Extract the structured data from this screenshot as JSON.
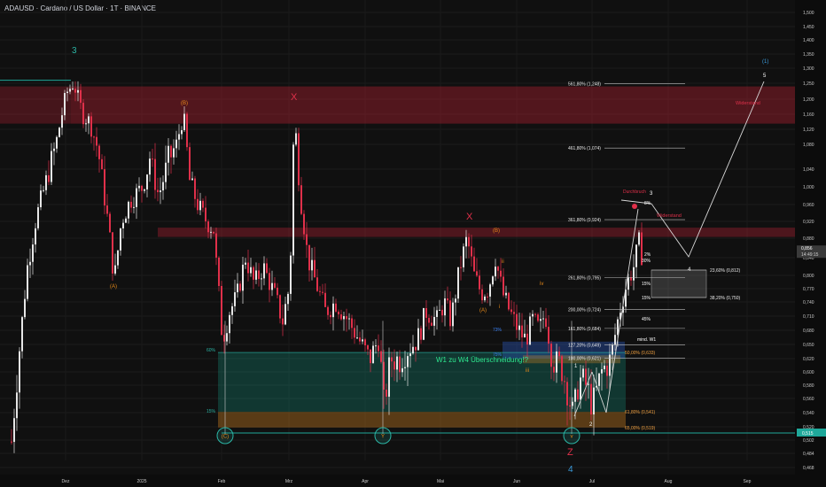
{
  "header": {
    "title": "ADAUSD · Cardano / US Dollar · 1T · BINANCE"
  },
  "chart_data": {
    "type": "candlestick",
    "price_axis": {
      "ticks": [
        "1,500",
        "1,450",
        "1,400",
        "1,350",
        "1,300",
        "1,250",
        "1,200",
        "1,160",
        "1,120",
        "1,080",
        "1,040",
        "1,000",
        "0,960",
        "0,920",
        "0,880",
        "0,840",
        "0,800",
        "0,770",
        "0,740",
        "0,710",
        "0,680",
        "0,650",
        "0,620",
        "0,600",
        "0,580",
        "0,560",
        "0,540",
        "0,520",
        "0,502",
        "0,484",
        "0,468"
      ],
      "current_price": "0,856",
      "countdown": "14:49:15",
      "marker_price": "0,515"
    },
    "time_axis": {
      "ticks": [
        "Dez",
        "2025",
        "Feb",
        "Mrz",
        "Apr",
        "Mai",
        "Jun",
        "Jul",
        "Aug",
        "Sep"
      ]
    },
    "zones": [
      {
        "label": "Widerstand",
        "from": 1.135,
        "to": 1.24,
        "kind": "resistance"
      },
      {
        "label": "",
        "from": 0.883,
        "to": 0.905,
        "kind": "resistance"
      },
      {
        "label": "Widerstand",
        "from": 0.883,
        "to": 0.905,
        "kind": "resistance-label"
      }
    ],
    "fib_levels": [
      {
        "label": "561,80% (1,248)",
        "price": 1.248
      },
      {
        "label": "461,80% (1,074)",
        "price": 1.074
      },
      {
        "label": "361,80% (0,924)",
        "price": 0.924
      },
      {
        "label": "261,80% (0,795)",
        "price": 0.795
      },
      {
        "label": "200,00% (0,724)",
        "price": 0.724
      },
      {
        "label": "161,80% (0,684)",
        "price": 0.684
      },
      {
        "label": "127,20% (0,649)",
        "price": 0.649
      },
      {
        "label": "100,00% (0,621)",
        "price": 0.621
      },
      {
        "label": "61,80% (0,541)",
        "price": 0.541
      },
      {
        "label": "65,00% (0,519)",
        "price": 0.519
      },
      {
        "label": "50,00% (0,633)",
        "price": 0.633
      },
      {
        "label": "23,60% (0,812)",
        "price": 0.812
      },
      {
        "label": "38,20% (0,750)",
        "price": 0.75
      }
    ],
    "small_labels": [
      "8%",
      "2%",
      "30%",
      "15%",
      "15%",
      "45%",
      "mind. W1",
      "60%",
      "15%",
      "73%",
      "75%",
      "61,80% (0,6..)",
      "50,00% (0,6..)",
      "61,80% (0,6..)",
      "65,00% (0,6..)"
    ],
    "wave_labels": {
      "green": [
        "3",
        "4"
      ],
      "orange": [
        "(A)",
        "(B)",
        "(A)",
        "(B)",
        "ii",
        "iv",
        "i",
        "iii"
      ],
      "red": [
        "X",
        "X",
        "Z"
      ],
      "white": [
        "1",
        "2",
        "3",
        "4",
        "5"
      ],
      "circled": [
        "(C)",
        "Y",
        "v"
      ],
      "blue": [
        "(1)"
      ],
      "extra": [
        "Durchbruch",
        "W1 zu W4 Überschneidung!?"
      ]
    }
  }
}
